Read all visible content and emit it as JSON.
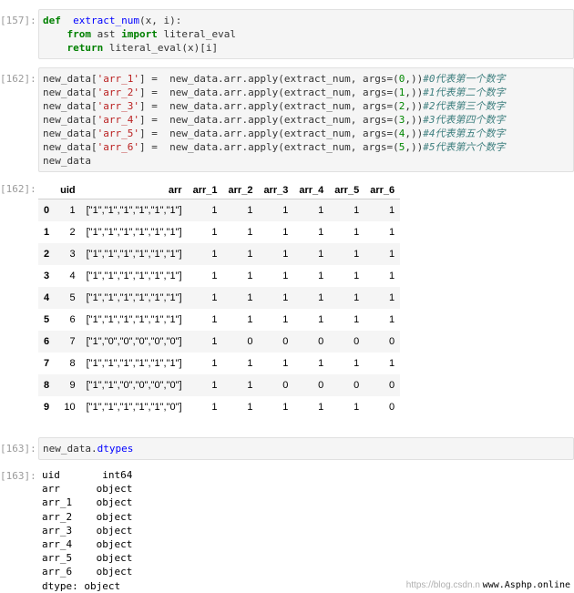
{
  "cells": [
    {
      "prompt": "[157]:",
      "lines": [
        [
          [
            "kw",
            "def"
          ],
          [
            "",
            "  "
          ],
          [
            "fn",
            "extract_num"
          ],
          [
            "",
            "(x, i):"
          ]
        ],
        [
          [
            "",
            "    "
          ],
          [
            "kw",
            "from"
          ],
          [
            "",
            " ast "
          ],
          [
            "kw",
            "import"
          ],
          [
            "",
            " literal_eval"
          ]
        ],
        [
          [
            "",
            "    "
          ],
          [
            "kw",
            "return"
          ],
          [
            "",
            " literal_eval(x)[i]"
          ]
        ]
      ]
    },
    {
      "prompt": "[162]:",
      "lines": [
        [
          [
            "",
            "new_data["
          ],
          [
            "st",
            "'arr_1'"
          ],
          [
            "",
            "] =  new_data.arr.apply(extract_num, args=("
          ],
          [
            "nm",
            "0"
          ],
          [
            "",
            ",))"
          ],
          [
            "cm",
            "#0代表第一个数字"
          ]
        ],
        [
          [
            "",
            "new_data["
          ],
          [
            "st",
            "'arr_2'"
          ],
          [
            "",
            "] =  new_data.arr.apply(extract_num, args=("
          ],
          [
            "nm",
            "1"
          ],
          [
            "",
            ",))"
          ],
          [
            "cm",
            "#1代表第二个数字"
          ]
        ],
        [
          [
            "",
            "new_data["
          ],
          [
            "st",
            "'arr_3'"
          ],
          [
            "",
            "] =  new_data.arr.apply(extract_num, args=("
          ],
          [
            "nm",
            "2"
          ],
          [
            "",
            ",))"
          ],
          [
            "cm",
            "#2代表第三个数字"
          ]
        ],
        [
          [
            "",
            "new_data["
          ],
          [
            "st",
            "'arr_4'"
          ],
          [
            "",
            "] =  new_data.arr.apply(extract_num, args=("
          ],
          [
            "nm",
            "3"
          ],
          [
            "",
            ",))"
          ],
          [
            "cm",
            "#3代表第四个数字"
          ]
        ],
        [
          [
            "",
            "new_data["
          ],
          [
            "st",
            "'arr_5'"
          ],
          [
            "",
            "] =  new_data.arr.apply(extract_num, args=("
          ],
          [
            "nm",
            "4"
          ],
          [
            "",
            ",))"
          ],
          [
            "cm",
            "#4代表第五个数字"
          ]
        ],
        [
          [
            "",
            "new_data["
          ],
          [
            "st",
            "'arr_6'"
          ],
          [
            "",
            "] =  new_data.arr.apply(extract_num, args=("
          ],
          [
            "nm",
            "5"
          ],
          [
            "",
            ",))"
          ],
          [
            "cm",
            "#5代表第六个数字"
          ]
        ],
        [
          [
            "",
            "new_data"
          ]
        ]
      ]
    },
    {
      "prompt": "[163]:",
      "lines": [
        [
          [
            "",
            "new_data."
          ],
          [
            "fn",
            "dtypes"
          ]
        ]
      ]
    }
  ],
  "out_prompts": {
    "table": "[162]:",
    "dtypes": "[163]:"
  },
  "dataframe": {
    "columns": [
      "",
      "uid",
      "arr",
      "arr_1",
      "arr_2",
      "arr_3",
      "arr_4",
      "arr_5",
      "arr_6"
    ],
    "rows": [
      [
        "0",
        "1",
        "[\"1\",\"1\",\"1\",\"1\",\"1\",\"1\"]",
        "1",
        "1",
        "1",
        "1",
        "1",
        "1"
      ],
      [
        "1",
        "2",
        "[\"1\",\"1\",\"1\",\"1\",\"1\",\"1\"]",
        "1",
        "1",
        "1",
        "1",
        "1",
        "1"
      ],
      [
        "2",
        "3",
        "[\"1\",\"1\",\"1\",\"1\",\"1\",\"1\"]",
        "1",
        "1",
        "1",
        "1",
        "1",
        "1"
      ],
      [
        "3",
        "4",
        "[\"1\",\"1\",\"1\",\"1\",\"1\",\"1\"]",
        "1",
        "1",
        "1",
        "1",
        "1",
        "1"
      ],
      [
        "4",
        "5",
        "[\"1\",\"1\",\"1\",\"1\",\"1\",\"1\"]",
        "1",
        "1",
        "1",
        "1",
        "1",
        "1"
      ],
      [
        "5",
        "6",
        "[\"1\",\"1\",\"1\",\"1\",\"1\",\"1\"]",
        "1",
        "1",
        "1",
        "1",
        "1",
        "1"
      ],
      [
        "6",
        "7",
        "[\"1\",\"0\",\"0\",\"0\",\"0\",\"0\"]",
        "1",
        "0",
        "0",
        "0",
        "0",
        "0"
      ],
      [
        "7",
        "8",
        "[\"1\",\"1\",\"1\",\"1\",\"1\",\"1\"]",
        "1",
        "1",
        "1",
        "1",
        "1",
        "1"
      ],
      [
        "8",
        "9",
        "[\"1\",\"1\",\"0\",\"0\",\"0\",\"0\"]",
        "1",
        "1",
        "0",
        "0",
        "0",
        "0"
      ],
      [
        "9",
        "10",
        "[\"1\",\"1\",\"1\",\"1\",\"1\",\"0\"]",
        "1",
        "1",
        "1",
        "1",
        "1",
        "0"
      ]
    ]
  },
  "dtypes_output": "uid       int64\narr      object\narr_1    object\narr_2    object\narr_3    object\narr_4    object\narr_5    object\narr_6    object\ndtype: object",
  "watermark": {
    "csdn": "https://blog.csdn.n",
    "site": "www.Asphp.online"
  }
}
